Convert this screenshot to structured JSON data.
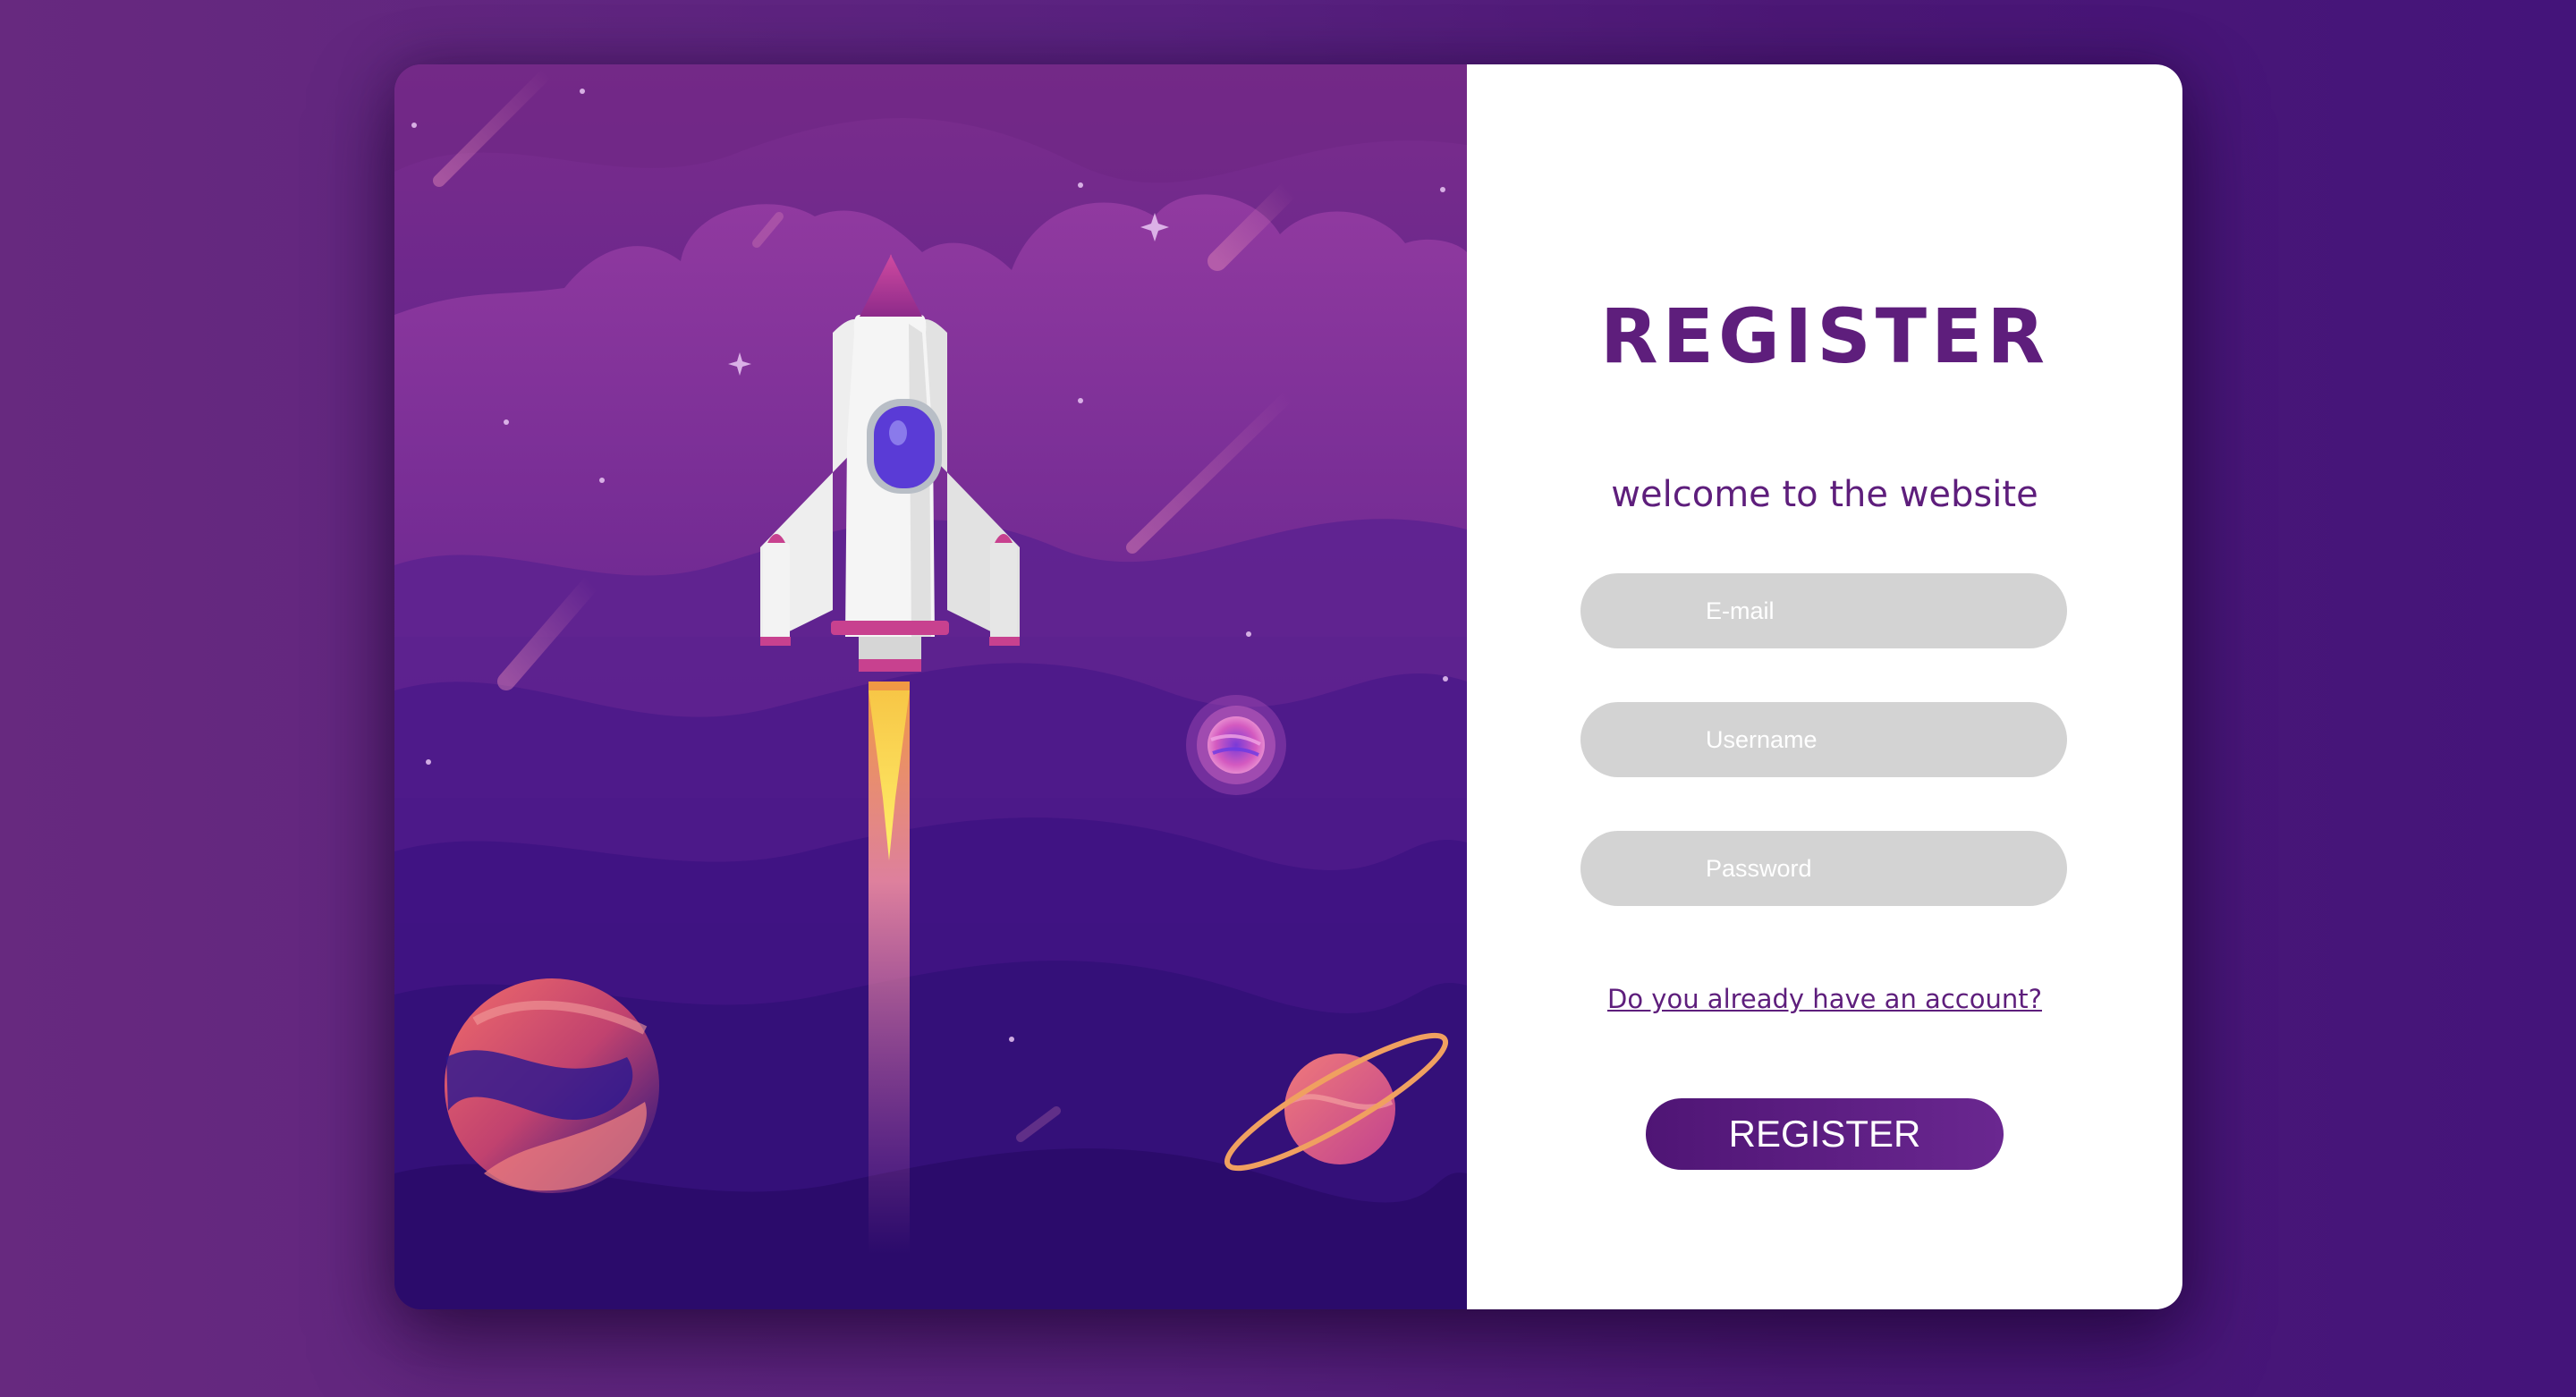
{
  "form": {
    "title": "REGISTER",
    "subtitle": "welcome to the website",
    "email_placeholder": "E-mail",
    "username_placeholder": "Username",
    "password_placeholder": "Password",
    "login_link": "Do you already have an account?",
    "submit_label": "REGISTER"
  },
  "colors": {
    "background": "#5a2280",
    "accent": "#5e1e7c",
    "field_bg": "#d3d3d3",
    "panel_bg": "#ffffff"
  },
  "illustration": {
    "icons": [
      "rocket-icon",
      "planet-icon",
      "ringed-planet-icon",
      "small-planet-icon",
      "cloud-icon",
      "star-icon",
      "meteor-icon"
    ]
  }
}
